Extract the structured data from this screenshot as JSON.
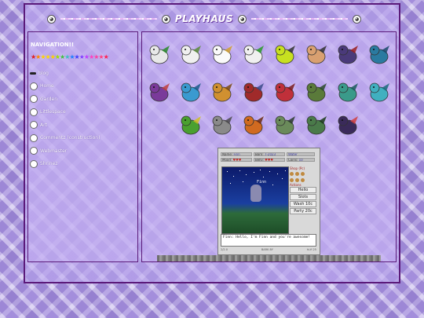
{
  "site": {
    "title": "PLAYHAUS"
  },
  "nav": {
    "heading": "NAVIGATION!!",
    "stars": [
      "★",
      "★",
      "★",
      "★",
      "★",
      "★",
      "★",
      "★",
      "★",
      "★",
      "★",
      "★",
      "★",
      "★",
      "★",
      "★"
    ],
    "star_colors": [
      "#e02020",
      "#ff8a00",
      "#ffd000",
      "#ffe000",
      "#ffd000",
      "#a0e000",
      "#40c040",
      "#40c0c0",
      "#2080ff",
      "#4040ff",
      "#8040ff",
      "#c040ff",
      "#ff40c0",
      "#ff40a0",
      "#ff4080",
      "#ff2050"
    ],
    "items": [
      {
        "label": "blog",
        "icon": "pen-icon"
      },
      {
        "label": "Home",
        "icon": "bunny-icon"
      },
      {
        "label": "Garden",
        "icon": "flower-icon"
      },
      {
        "label": "Littlespace",
        "icon": "teddy-icon"
      },
      {
        "label": "Art",
        "icon": "palette-icon"
      },
      {
        "label": "Commentz (construction)",
        "icon": "chat-icon"
      },
      {
        "label": "Webmaster",
        "icon": "computer-icon"
      },
      {
        "label": "Shrinez",
        "icon": "heart-icon"
      }
    ]
  },
  "pets": [
    {
      "name": "bunny-pet-1",
      "color": "#e8e8e8",
      "accent": "#2a8a2a"
    },
    {
      "name": "cat-pet",
      "color": "#f0f0f0",
      "accent": "#5a8a3a"
    },
    {
      "name": "fox-pet",
      "color": "#fafafa",
      "accent": "#d0a030"
    },
    {
      "name": "small-pet",
      "color": "#f0f0f0",
      "accent": "#2a9a2a"
    },
    {
      "name": "green-bag-pet",
      "color": "#c8e020",
      "accent": "#333333"
    },
    {
      "name": "cookie-pet",
      "color": "#d9a070",
      "accent": "#333333"
    },
    {
      "name": "dark-dragon-1",
      "color": "#4a3a7a",
      "accent": "#9a2020"
    },
    {
      "name": "blue-dragon-1",
      "color": "#2a7aa0",
      "accent": "#1a4a6a"
    },
    {
      "name": "purple-dragon",
      "color": "#7a3a9a",
      "accent": "#c04040"
    },
    {
      "name": "blue-lizard",
      "color": "#3a9ad0",
      "accent": "#1a5a8a"
    },
    {
      "name": "gold-dragon",
      "color": "#d09030",
      "accent": "#7a4a10"
    },
    {
      "name": "red-dragon-1",
      "color": "#a02a2a",
      "accent": "#3a4a8a"
    },
    {
      "name": "red-dragon-2",
      "color": "#c0303a",
      "accent": "#7a1a1a"
    },
    {
      "name": "green-dragon-1",
      "color": "#5a7a3a",
      "accent": "#2a4a2a"
    },
    {
      "name": "teal-dragon",
      "color": "#3a9a8a",
      "accent": "#1a5a5a"
    },
    {
      "name": "aqua-dragon",
      "color": "#40b0c0",
      "accent": "#1a6a7a"
    },
    {
      "name": "green-dragon-2",
      "color": "#4aa030",
      "accent": "#d0c020"
    },
    {
      "name": "grey-dragon",
      "color": "#8a8a8a",
      "accent": "#4a4a4a"
    },
    {
      "name": "fire-dragon",
      "color": "#d06a20",
      "accent": "#6a2a10"
    },
    {
      "name": "green-dragon-3",
      "color": "#6a8a5a",
      "accent": "#2a3a2a"
    },
    {
      "name": "green-dragon-4",
      "color": "#4a7a4a",
      "accent": "#1a3a1a"
    },
    {
      "name": "phoenix-pet",
      "color": "#3a2a5a",
      "accent": "#d04040"
    }
  ],
  "widget": {
    "name_label": "Name:",
    "name_value": "Finn",
    "born_label": "Born:",
    "born_value": "7-2023",
    "type_value": "Water",
    "mood_label": "Mood:",
    "belly_label": "Belly:",
    "coins_label": "Coins:",
    "coins_value": "10",
    "scene_name": "Finn",
    "shop_label": "Shop (Pc)",
    "actions_label": "Actions",
    "actions": [
      "Hello",
      "Slots",
      "Wash 10c",
      "Party 20c"
    ],
    "message": "Finn: Hello, I'm Finn and you're awesome!",
    "footer": [
      "2/2.0",
      "BARK 8Y",
      "hi-fi 25"
    ]
  }
}
